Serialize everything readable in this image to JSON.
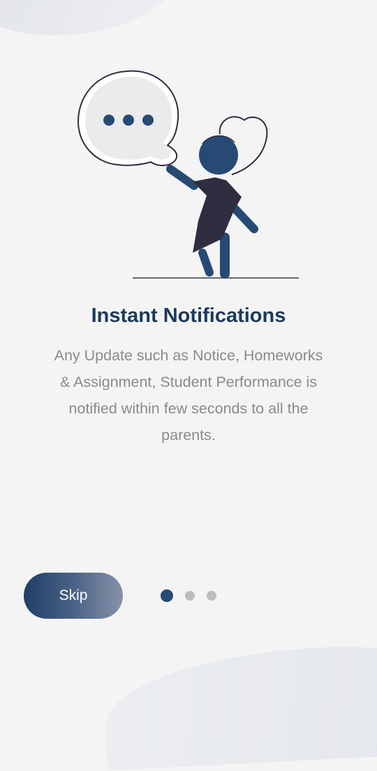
{
  "onboarding": {
    "title": "Instant Notifications",
    "description": "Any Update such as Notice, Homeworks & Assignment, Student Performance is notified within few seconds to all the parents.",
    "skip_label": "Skip",
    "pager": {
      "total": 3,
      "current": 1
    }
  },
  "colors": {
    "title": "#1b3a5e",
    "accent": "#264a74",
    "description": "#8a8a8a",
    "background": "#f4f4f4"
  }
}
